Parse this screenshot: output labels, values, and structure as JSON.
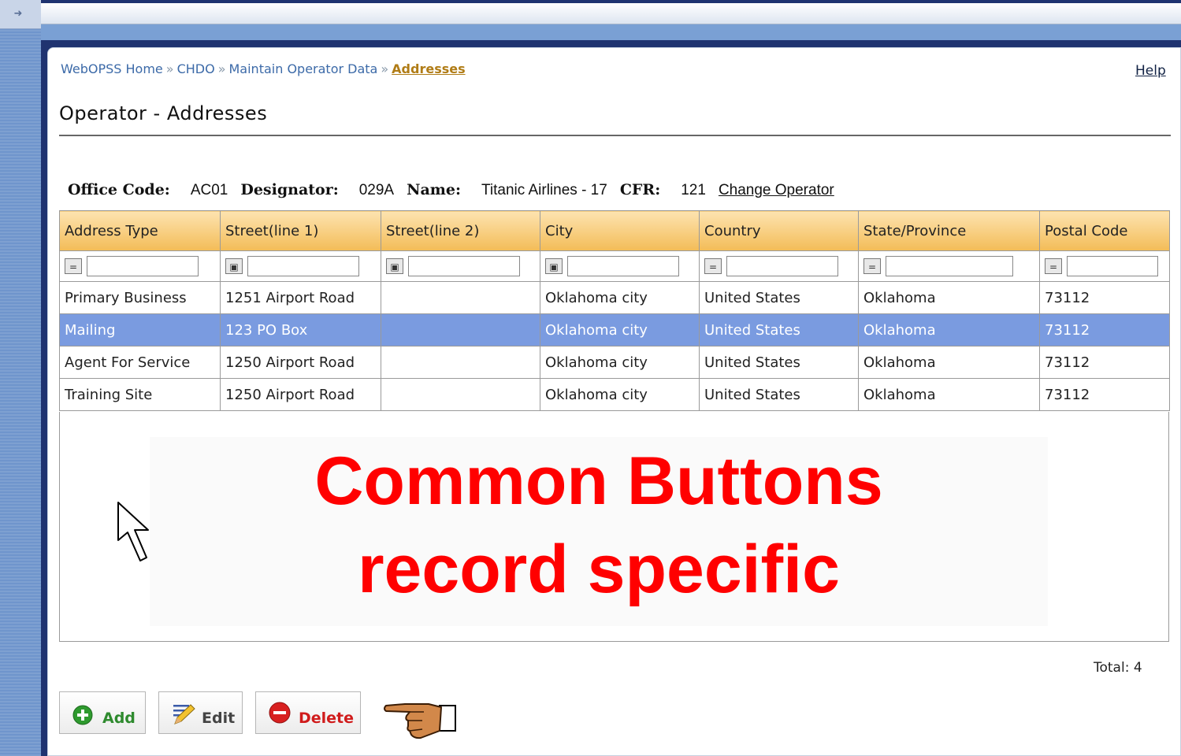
{
  "breadcrumb": {
    "items": [
      "WebOPSS Home",
      "CHDO",
      "Maintain Operator Data"
    ],
    "separator": "»",
    "current": "Addresses"
  },
  "help_label": "Help",
  "page_title": "Operator - Addresses",
  "operator": {
    "office_code_label": "Office Code:",
    "office_code": "AC01",
    "designator_label": "Designator:",
    "designator": "029A",
    "name_label": "Name:",
    "name": "Titanic Airlines - 17",
    "cfr_label": "CFR:",
    "cfr": "121",
    "change_link": "Change Operator"
  },
  "grid": {
    "columns": [
      "Address Type",
      "Street(line 1)",
      "Street(line 2)",
      "City",
      "Country",
      "State/Province",
      "Postal Code"
    ],
    "rows": [
      [
        "Primary Business",
        "1251 Airport Road",
        "",
        "Oklahoma city",
        "United States",
        "Oklahoma",
        "73112"
      ],
      [
        "Mailing",
        "123 PO Box",
        "",
        "Oklahoma city",
        "United States",
        "Oklahoma",
        "73112"
      ],
      [
        "Agent For Service",
        "1250 Airport Road",
        "",
        "Oklahoma city",
        "United States",
        "Oklahoma",
        "73112"
      ],
      [
        "Training Site",
        "1250 Airport Road",
        "",
        "Oklahoma city",
        "United States",
        "Oklahoma",
        "73112"
      ]
    ],
    "selected_row": 1,
    "total": "Total: 4"
  },
  "overlay": {
    "line1": "Common Buttons",
    "line2": "record specific"
  },
  "buttons": {
    "add": "Add",
    "edit": "Edit",
    "delete": "Delete"
  },
  "colors": {
    "header_gradient_top": "#fde3b0",
    "header_gradient_bottom": "#f3bc57",
    "selected_row": "#7a9be0",
    "overlay_text": "#ff0000",
    "slide_background": "#1f3370"
  },
  "icons": [
    "arrow-right-icon",
    "filter-equals-icon",
    "filter-contains-icon",
    "cursor-arrow-icon",
    "add-plus-icon",
    "edit-pencil-icon",
    "delete-minus-icon",
    "pointing-hand-icon"
  ]
}
